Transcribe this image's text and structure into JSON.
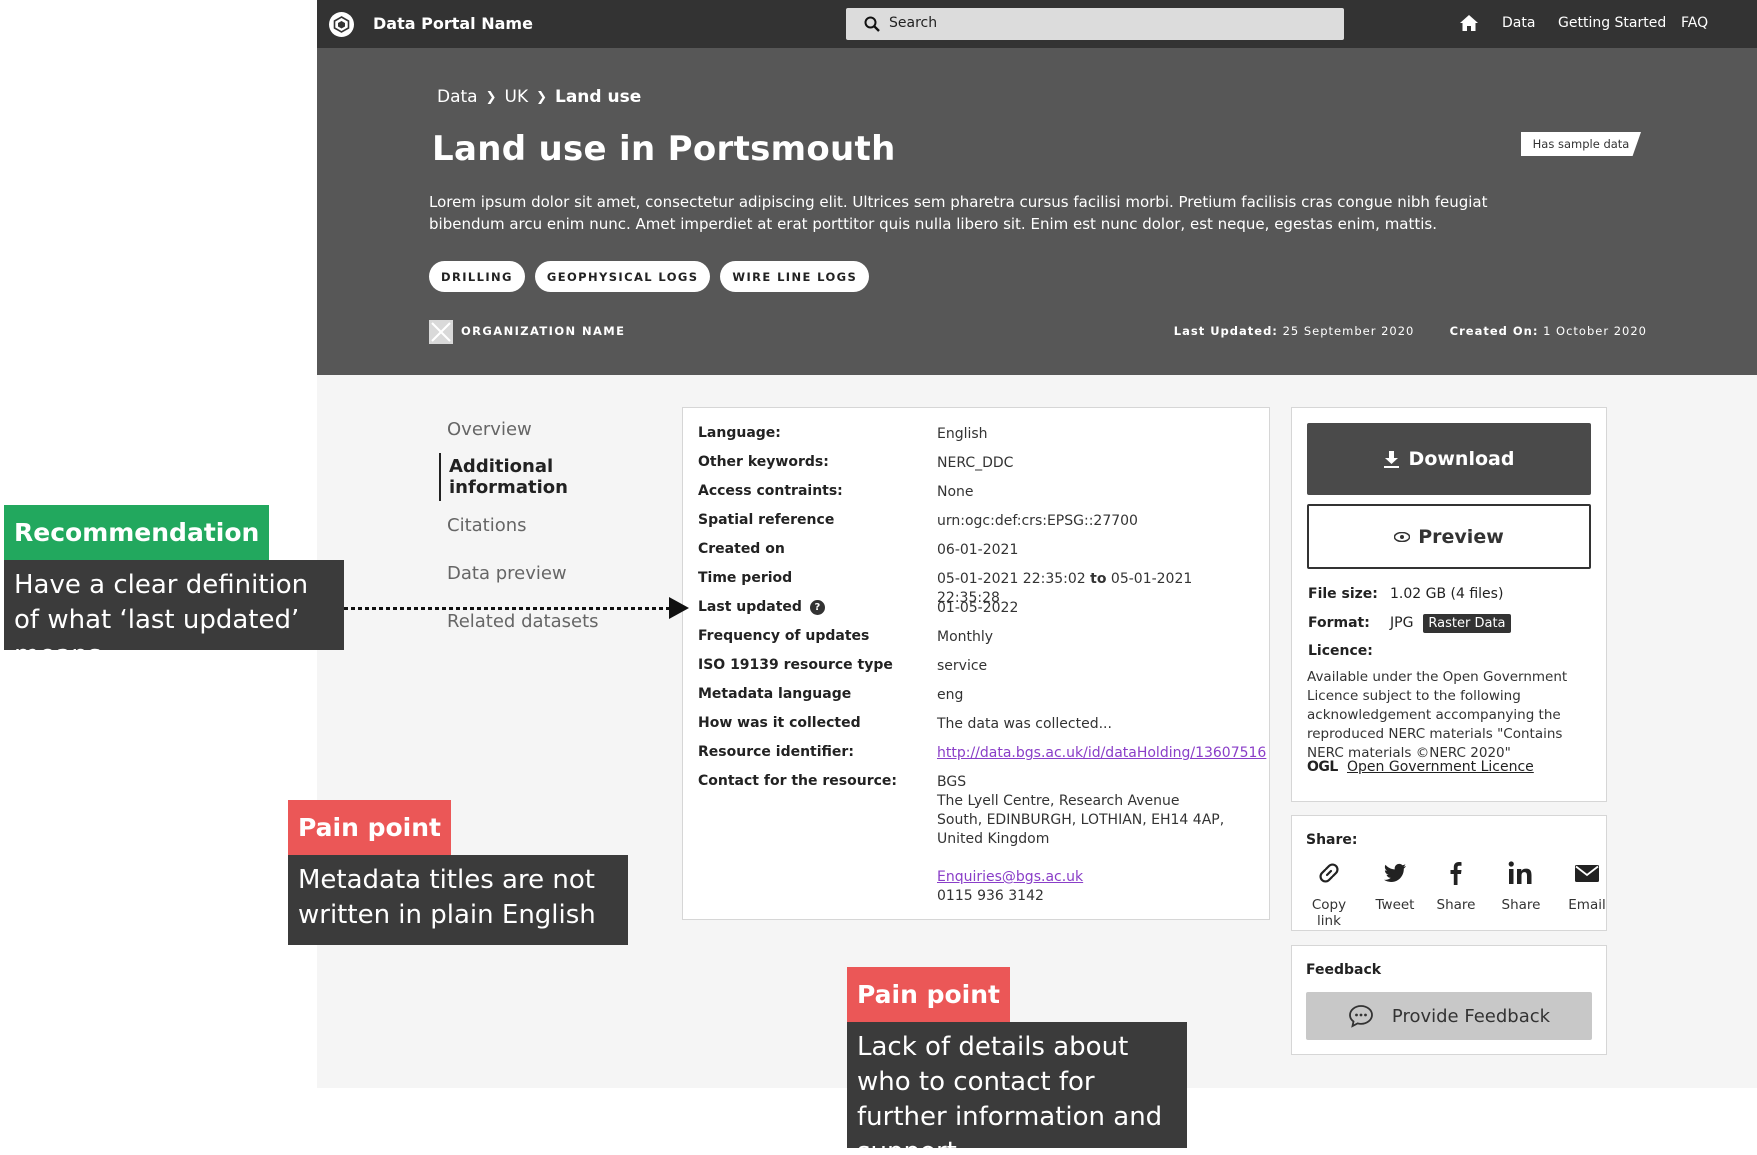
{
  "topnav": {
    "portal_name": "Data Portal Name",
    "search_placeholder": "Search",
    "links": [
      "Data",
      "Getting Started",
      "FAQ"
    ]
  },
  "hero": {
    "breadcrumb": [
      "Data",
      "UK",
      "Land use"
    ],
    "title": "Land use in Portsmouth",
    "badge": "Has sample data",
    "description": "Lorem ipsum dolor sit amet, consectetur adipiscing elit. Ultrices sem pharetra cursus facilisi morbi. Pretium facilisis cras congue nibh feugiat bibendum arcu enim nunc. Amet imperdiet at erat porttitor quis nulla libero sit. Enim est nunc dolor, est neque, egestas enim, mattis.",
    "tags": [
      "DRILLING",
      "GEOPHYSICAL LOGS",
      "WIRE LINE LOGS"
    ],
    "organization": "ORGANIZATION NAME",
    "last_updated_label": "Last Updated:",
    "last_updated_value": "25 September 2020",
    "created_on_label": "Created On:",
    "created_on_value": "1 October 2020"
  },
  "sidenav": {
    "items": [
      "Overview",
      "Additional information",
      "Citations",
      "Data preview",
      "Related datasets"
    ],
    "active_index": 1
  },
  "metadata": {
    "rows": [
      {
        "key": "Language:",
        "value": "English"
      },
      {
        "key": "Other keywords:",
        "value": "NERC_DDC"
      },
      {
        "key": "Access contraints:",
        "value": "None"
      },
      {
        "key": "Spatial reference",
        "value": "urn:ogc:def:crs:EPSG::27700"
      },
      {
        "key": "Created on",
        "value": "06-01-2021"
      },
      {
        "key": "Time period",
        "value_from": "05-01-2021 22:35:02",
        "value_to_label": "to",
        "value_to": "05-01-2021 22:35:28"
      },
      {
        "key": "Last updated",
        "value": "01-05-2022"
      },
      {
        "key": "Frequency of updates",
        "value": "Monthly"
      },
      {
        "key": "ISO 19139 resource type",
        "value": "service"
      },
      {
        "key": "Metadata language",
        "value": "eng"
      },
      {
        "key": "How was it collected",
        "value": "The data was collected..."
      },
      {
        "key": "Resource identifier:",
        "value": "http://data.bgs.ac.uk/id/dataHolding/13607516"
      },
      {
        "key": "Contact for the resource:",
        "org": "BGS",
        "address": "The Lyell Centre, Research Avenue South, EDINBURGH, LOTHIAN, EH14 4AP, United Kingdom",
        "email": "Enquiries@bgs.ac.uk",
        "phone": "0115 936 3142"
      }
    ]
  },
  "download": {
    "download_label": "Download",
    "preview_label": "Preview",
    "file_size_label": "File size:",
    "file_size_value": "1.02 GB (4 files)",
    "format_label": "Format:",
    "format_value": "JPG",
    "format_badge": "Raster Data",
    "licence_label": "Licence:",
    "licence_text": "Available under the Open Government Licence subject to the following acknowledgement accompanying the reproduced NERC materials \"Contains NERC materials ©NERC 2020\"",
    "ogl_logo": "OGL",
    "ogl_link": "Open Government Licence"
  },
  "share": {
    "title": "Share:",
    "items": [
      {
        "label": "Copy link",
        "icon": "link-icon"
      },
      {
        "label": "Tweet",
        "icon": "twitter-icon"
      },
      {
        "label": "Share",
        "icon": "facebook-icon"
      },
      {
        "label": "Share",
        "icon": "linkedin-icon"
      },
      {
        "label": "Email",
        "icon": "email-icon"
      }
    ]
  },
  "feedback": {
    "title": "Feedback",
    "button": "Provide Feedback"
  },
  "annotations": {
    "recommendation": {
      "head": "Recommendation",
      "body": "Have a clear definition of what ‘last updated’ means"
    },
    "pain1": {
      "head": "Pain point",
      "body": "Metadata titles are not written in plain English"
    },
    "pain2": {
      "head": "Pain point",
      "body": "Lack of details about who to contact for further information and support"
    }
  },
  "colors": {
    "nav": "#333333",
    "hero": "#575757",
    "recommendation": "#22a85e",
    "pain_point": "#eb5757",
    "link": "#8a3ec8"
  }
}
